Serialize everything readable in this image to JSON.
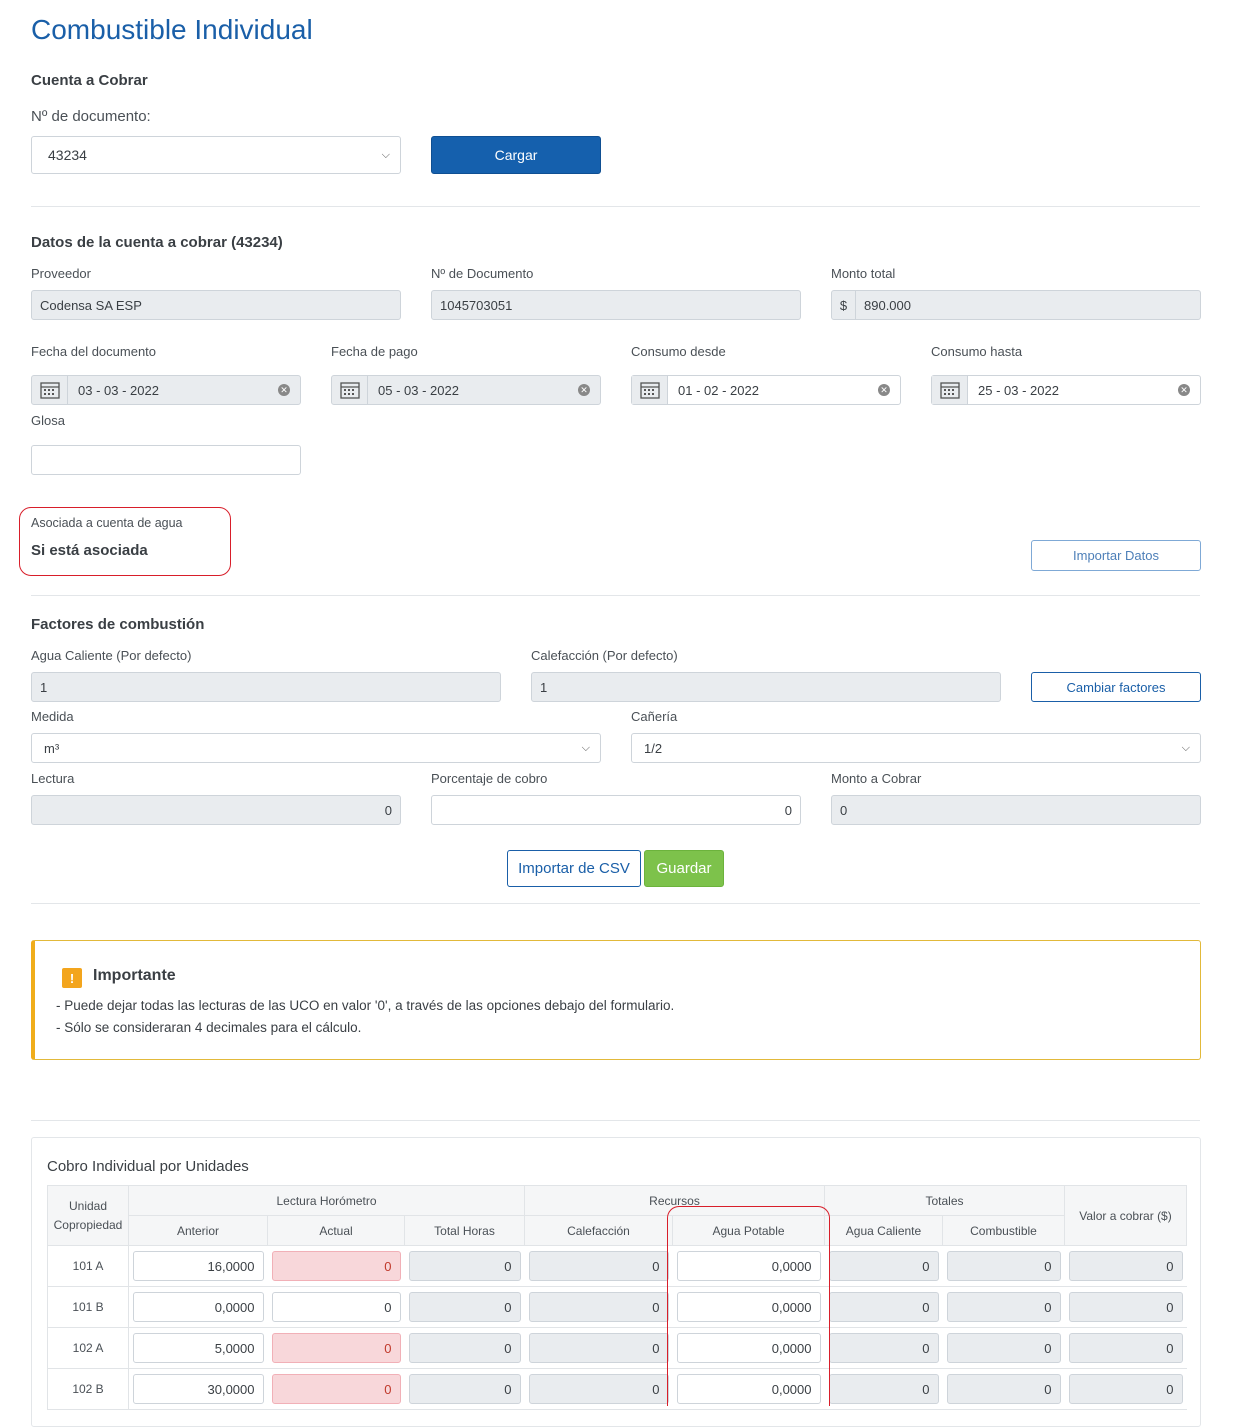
{
  "page": {
    "title": "Combustible Individual"
  },
  "cuenta": {
    "section_title": "Cuenta a Cobrar",
    "doc_label": "Nº de documento:",
    "doc_value": "43234",
    "load_button": "Cargar"
  },
  "datos": {
    "section_title": "Datos de la cuenta a cobrar (43234)",
    "proveedor_label": "Proveedor",
    "proveedor_value": "Codensa SA ESP",
    "ndoc_label": "Nº de Documento",
    "ndoc_value": "1045703051",
    "monto_label": "Monto total",
    "monto_prefix": "$",
    "monto_value": "890.000",
    "fecha_doc_label": "Fecha del documento",
    "fecha_doc_value": "03 - 03 - 2022",
    "fecha_pago_label": "Fecha de pago",
    "fecha_pago_value": "05 - 03 - 2022",
    "consumo_desde_label": "Consumo desde",
    "consumo_desde_value": "01 - 02 - 2022",
    "consumo_hasta_label": "Consumo hasta",
    "consumo_hasta_value": "25 - 03 - 2022",
    "glosa_label": "Glosa",
    "glosa_value": "",
    "asociada_label": "Asociada a cuenta de agua",
    "asociada_value": "Si está asociada",
    "import_button": "Importar Datos"
  },
  "factores": {
    "section_title": "Factores de combustión",
    "agua_label": "Agua Caliente (Por defecto)",
    "agua_value": "1",
    "calef_label": "Calefacción (Por defecto)",
    "calef_value": "1",
    "change_button": "Cambiar factores",
    "medida_label": "Medida",
    "medida_value": "m³",
    "caneria_label": "Cañería",
    "caneria_value": "1/2",
    "lectura_label": "Lectura",
    "lectura_value": "0",
    "porcentaje_label": "Porcentaje de cobro",
    "porcentaje_value": "0",
    "monto_cobrar_label": "Monto a Cobrar",
    "monto_cobrar_value": "0",
    "csv_button": "Importar de CSV",
    "save_button": "Guardar"
  },
  "alert": {
    "icon_text": "!",
    "title": "Importante",
    "line1": "- Puede dejar todas las lecturas de las UCO en valor '0', a través de las opciones debajo del formulario.",
    "line2": "- Sólo se consideraran 4 decimales para el cálculo."
  },
  "table": {
    "title": "Cobro Individual por Unidades",
    "h_unidad": "Unidad Copropiedad",
    "h_lectura": "Lectura Horómetro",
    "h_recursos": "Recursos",
    "h_totales": "Totales",
    "h_valor": "Valor a cobrar ($)",
    "h_anterior": "Anterior",
    "h_actual": "Actual",
    "h_total_horas": "Total Horas",
    "h_calefaccion": "Calefacción",
    "h_agua_potable": "Agua Potable",
    "h_agua_caliente": "Agua Caliente",
    "h_combustible": "Combustible",
    "rows": [
      {
        "unit": "101 A",
        "anterior": "16,0000",
        "actual": "0",
        "actual_err": true,
        "total_horas": "0",
        "calefaccion": "0",
        "agua_potable": "0,0000",
        "agua_caliente": "0",
        "combustible": "0",
        "valor": "0"
      },
      {
        "unit": "101 B",
        "anterior": "0,0000",
        "actual": "0",
        "actual_err": false,
        "total_horas": "0",
        "calefaccion": "0",
        "agua_potable": "0,0000",
        "agua_caliente": "0",
        "combustible": "0",
        "valor": "0"
      },
      {
        "unit": "102 A",
        "anterior": "5,0000",
        "actual": "0",
        "actual_err": true,
        "total_horas": "0",
        "calefaccion": "0",
        "agua_potable": "0,0000",
        "agua_caliente": "0",
        "combustible": "0",
        "valor": "0"
      },
      {
        "unit": "102 B",
        "anterior": "30,0000",
        "actual": "0",
        "actual_err": true,
        "total_horas": "0",
        "calefaccion": "0",
        "agua_potable": "0,0000",
        "agua_caliente": "0",
        "combustible": "0",
        "valor": "0"
      }
    ]
  },
  "colors": {
    "primary": "#1560ad",
    "success": "#7dc24b",
    "warning": "#f0ad1a",
    "highlight": "#d81e2a",
    "error_bg": "#f8d7da"
  }
}
